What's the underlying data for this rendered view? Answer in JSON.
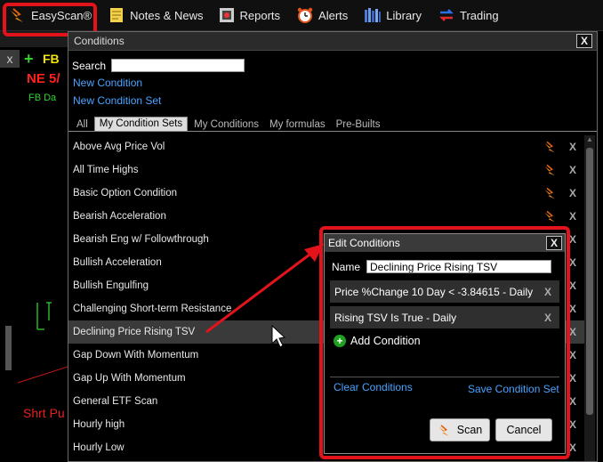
{
  "menubar": {
    "items": [
      {
        "label": "EasyScan®",
        "icon": "easyscan-icon"
      },
      {
        "label": "Notes & News",
        "icon": "notes-icon"
      },
      {
        "label": "Reports",
        "icon": "reports-icon"
      },
      {
        "label": "Alerts",
        "icon": "alarm-clock-icon"
      },
      {
        "label": "Library",
        "icon": "library-icon"
      },
      {
        "label": "Trading",
        "icon": "trading-icon"
      }
    ]
  },
  "background": {
    "tool_label": "x",
    "symbol": "FB",
    "ticker_line": "NE 5/",
    "small_label": "FB Da",
    "bottom_label": "Shrt Pu"
  },
  "conditions": {
    "title": "Conditions",
    "close": "X",
    "search_label": "Search",
    "search_value": "",
    "new_condition": "New Condition",
    "new_condition_set": "New Condition Set",
    "tabs": [
      "All",
      "My Condition Sets",
      "My Conditions",
      "My formulas",
      "Pre-Builts"
    ],
    "active_tab": "My Condition Sets",
    "row_delete": "X",
    "items": [
      "Above Avg Price Vol",
      "All Time Highs",
      "Basic Option Condition",
      "Bearish Acceleration",
      "Bearish Eng w/ Followthrough",
      "Bullish Acceleration",
      "Bullish Engulfing",
      "Challenging Short-term Resistance",
      "Declining Price Rising TSV",
      "Gap Down With Momentum",
      "Gap Up With Momentum",
      "General ETF Scan",
      "Hourly high",
      "Hourly Low"
    ],
    "selected_item": "Declining Price Rising TSV"
  },
  "edit": {
    "title": "Edit Conditions",
    "close": "X",
    "name_label": "Name",
    "name_value": "Declining Price Rising TSV",
    "criteria": [
      "Price %Change 10 Day < -3.84615 - Daily",
      "Rising TSV Is True - Daily"
    ],
    "criteria_delete": "X",
    "add_condition": "Add Condition",
    "clear_conditions": "Clear Conditions",
    "save_condition_set": "Save Condition Set",
    "scan_button": "Scan",
    "cancel_button": "Cancel"
  },
  "colors": {
    "highlight": "#e3131b",
    "link": "#4aa3ff",
    "selected_row": "#3a3a3a"
  }
}
